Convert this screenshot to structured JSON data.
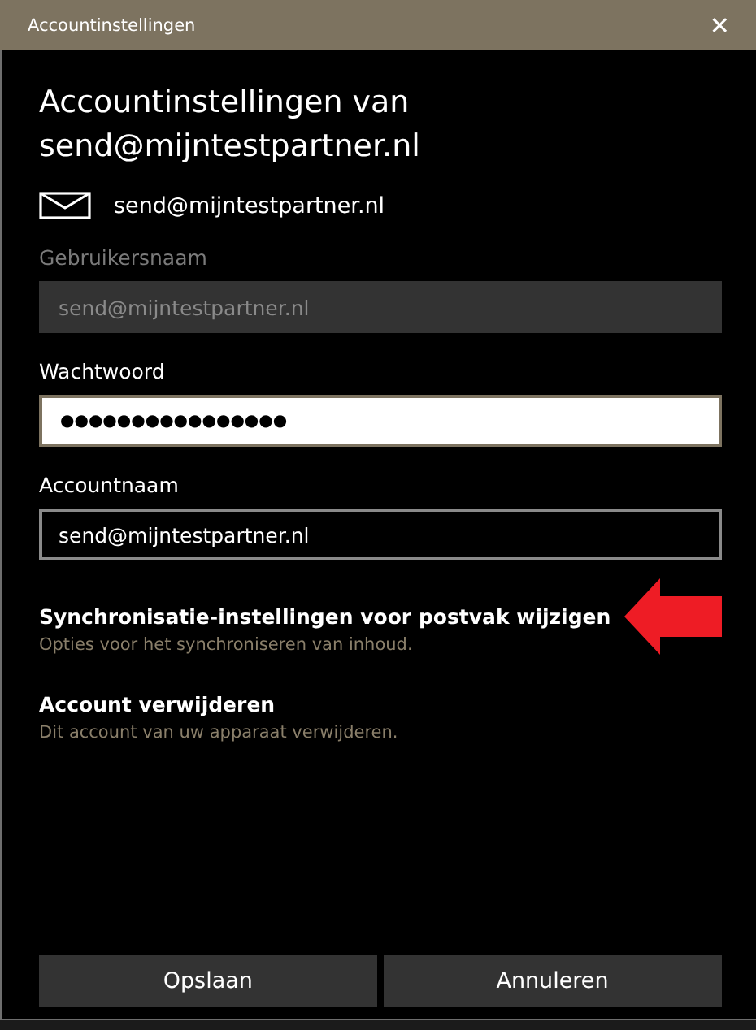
{
  "window": {
    "title": "Accountinstellingen",
    "close": "✕"
  },
  "heading": "Accountinstellingen van send@mijntestpartner.nl",
  "account_email": "send@mijntestpartner.nl",
  "fields": [
    {
      "label": "Gebruikersnaam",
      "value": "send@mijntestpartner.nl",
      "disabled": true,
      "focused": false
    },
    {
      "label": "Wachtwoord",
      "value": "●●●●●●●●●●●●●●●●",
      "disabled": false,
      "focused": true
    },
    {
      "label": "Accountnaam",
      "value": "send@mijntestpartner.nl",
      "disabled": false,
      "focused": false
    }
  ],
  "links": [
    {
      "title": "Synchronisatie-instellingen voor postvak wijzigen",
      "description": "Opties voor het synchroniseren van inhoud.",
      "annotated": true
    },
    {
      "title": "Account verwijderen",
      "description": "Dit account van uw apparaat verwijderen.",
      "annotated": false
    }
  ],
  "buttons": [
    "Opslaan",
    "Annuleren"
  ]
}
